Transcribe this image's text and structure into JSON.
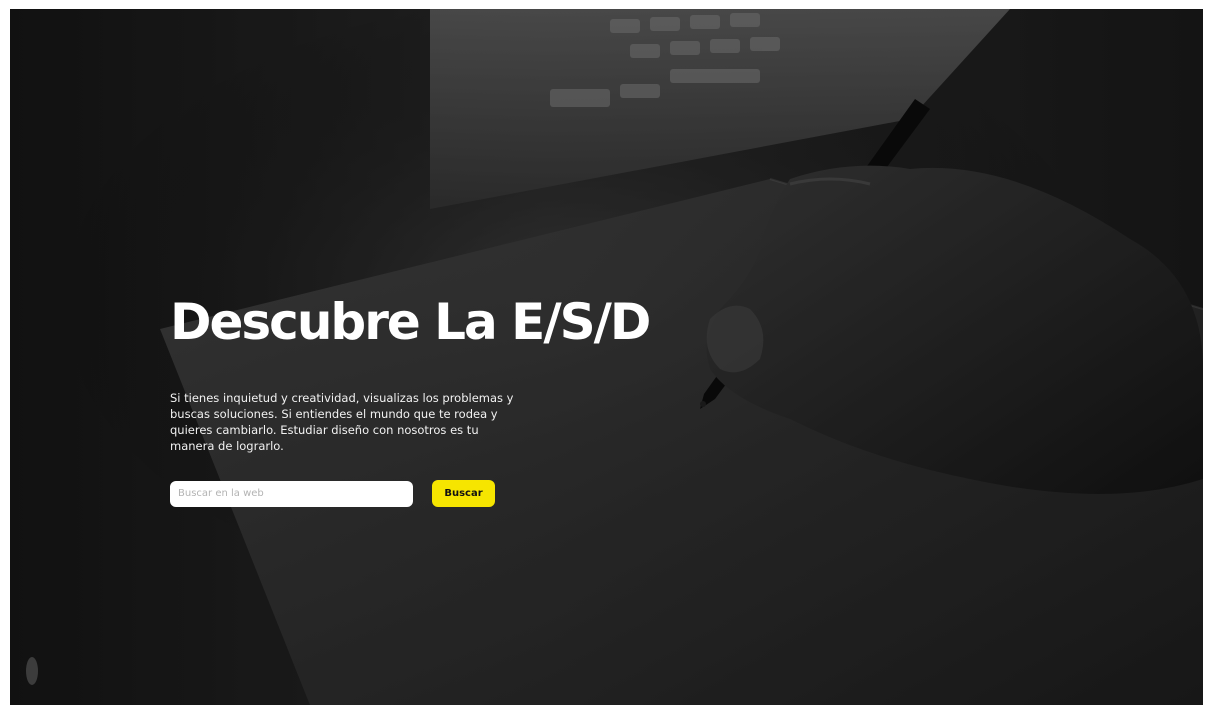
{
  "hero": {
    "title": "Descubre La E/S/D",
    "description": "Si tienes inquietud y creatividad, visualizas los problemas y buscas soluciones. Si entiendes el mundo que te rodea y quieres cambiarlo. Estudiar diseño con nosotros es tu manera de lograrlo.",
    "background_image": "hand-drawing-on-tablet-photo"
  },
  "search": {
    "placeholder": "Buscar en la web",
    "value": "",
    "button_label": "Buscar"
  },
  "colors": {
    "accent": "#f6e500",
    "overlay": "#1e1e1e",
    "text": "#ffffff"
  }
}
